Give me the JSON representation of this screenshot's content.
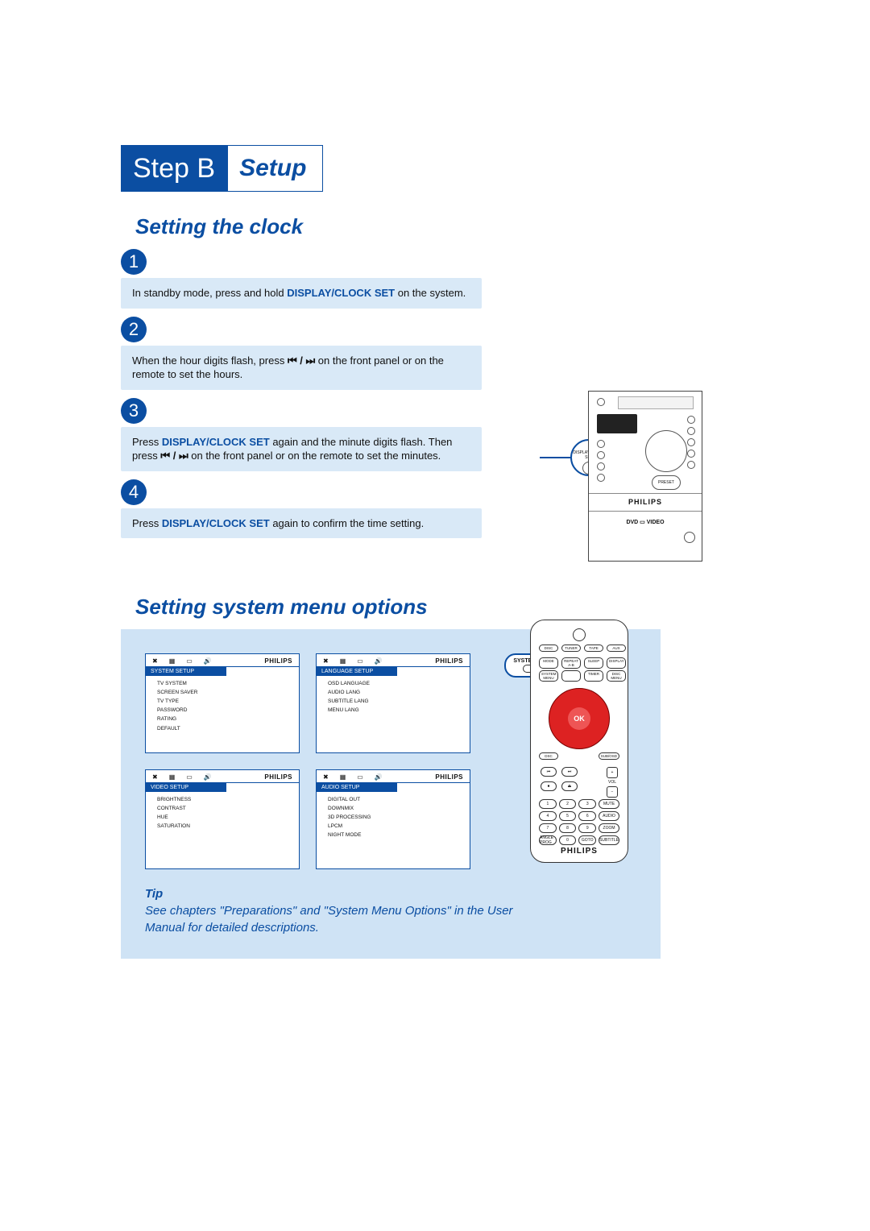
{
  "header": {
    "step_label": "Step B",
    "setup_label": "Setup"
  },
  "clock": {
    "title": "Setting the clock",
    "steps": [
      {
        "num": "1",
        "pre": "In standby mode, press and hold ",
        "bold": "DISPLAY/CLOCK SET",
        "post": " on the system."
      },
      {
        "num": "2",
        "pre": "When the hour digits flash, press ",
        "icons": "⏮ / ⏭",
        "post": " on the front panel or on the remote to set the hours."
      },
      {
        "num": "3",
        "pre": "Press ",
        "bold": "DISPLAY/CLOCK SET",
        "mid": " again and the minute digits flash. Then press  ",
        "icons": "⏮ / ⏭",
        "post": "  on the front panel or on the remote to set the minutes."
      },
      {
        "num": "4",
        "pre": "Press ",
        "bold": "DISPLAY/CLOCK SET",
        "post": " again to confirm the time setting."
      }
    ],
    "callout_label": "DISPLAY/CLOCK SET",
    "device": {
      "preset": "PRESET",
      "brand": "PHILIPS",
      "dvd": "DVD ▭ VIDEO"
    }
  },
  "menu": {
    "title": "Setting system menu options",
    "brand": "PHILIPS",
    "cards": [
      {
        "title": "SYSTEM SETUP",
        "items": [
          "TV SYSTEM",
          "SCREEN SAVER",
          "TV TYPE",
          "PASSWORD",
          "RATING",
          "DEFAULT"
        ]
      },
      {
        "title": "LANGUAGE SETUP",
        "items": [
          "OSD LANGUAGE",
          "AUDIO LANG",
          "SUBTITLE LANG",
          "MENU LANG"
        ]
      },
      {
        "title": "VIDEO SETUP",
        "items": [
          "BRIGHTNESS",
          "CONTRAST",
          "HUE",
          "SATURATION"
        ]
      },
      {
        "title": "AUDIO SETUP",
        "items": [
          "DIGITAL OUT",
          "DOWNMIX",
          "3D PROCESSING",
          "LPCM",
          "NIGHT MODE"
        ]
      }
    ],
    "tip_head": "Tip",
    "tip_body": "See chapters \"Preparations\" and \"System Menu Options\" in the User Manual for detailed descriptions.",
    "remote": {
      "callout": "SYSTEM MENU",
      "row_top": [
        "DISC",
        "TUNER",
        "TAPE",
        "AUX"
      ],
      "row2": [
        "MODE",
        "REPEAT A-B",
        "SLEEP",
        "DISPLAY"
      ],
      "row3": [
        "SYSTEM MENU",
        "",
        "TIMER",
        "DISC MENU"
      ],
      "ok": "OK",
      "below": [
        "DSC",
        "SUB/OSD"
      ],
      "trans1": [
        "⏮",
        "⏭"
      ],
      "trans2": [
        "⏹",
        "⏏"
      ],
      "vol_label": "VOL",
      "numpad": [
        "1",
        "2",
        "3",
        "MUTE",
        "4",
        "5",
        "6",
        "AUDIO",
        "7",
        "8",
        "9",
        "ZOOM",
        "ANGLE\nPROG",
        "0",
        "GOTO",
        "SUBTITLE"
      ],
      "brand": "PHILIPS"
    }
  }
}
